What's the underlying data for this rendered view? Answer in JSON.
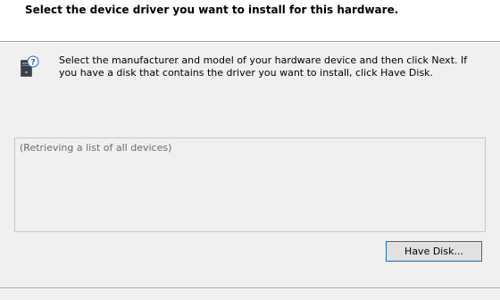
{
  "header": {
    "title": "Select the device driver you want to install for this hardware."
  },
  "content": {
    "instructions": "Select the manufacturer and model of your hardware device and then click Next. If you have a disk that contains the driver you want to install, click Have Disk.",
    "icon": "hardware-device-icon",
    "device_list_status": "(Retrieving a list of all devices)"
  },
  "buttons": {
    "have_disk_label": "Have Disk..."
  },
  "colors": {
    "header_background": "#ffffff",
    "window_background": "#f0f0f0",
    "button_focus_border": "#0078d7",
    "list_status_text": "#6d6d6d"
  }
}
